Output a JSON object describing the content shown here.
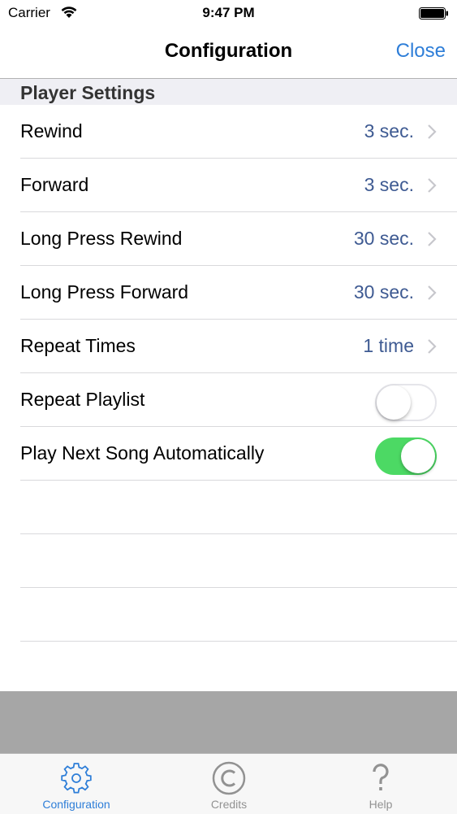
{
  "status_bar": {
    "carrier": "Carrier",
    "time": "9:47 PM"
  },
  "nav": {
    "title": "Configuration",
    "close_label": "Close"
  },
  "section": {
    "header": "Player Settings"
  },
  "settings": {
    "rewind": {
      "label": "Rewind",
      "value": "3 sec."
    },
    "forward": {
      "label": "Forward",
      "value": "3 sec."
    },
    "long_press_rewind": {
      "label": "Long Press Rewind",
      "value": "30 sec."
    },
    "long_press_forward": {
      "label": "Long Press Forward",
      "value": "30 sec."
    },
    "repeat_times": {
      "label": "Repeat Times",
      "value": "1 time"
    },
    "repeat_playlist": {
      "label": "Repeat Playlist",
      "on": false
    },
    "play_next": {
      "label": "Play Next Song Automatically",
      "on": true
    }
  },
  "tabs": [
    {
      "label": "Configuration",
      "icon": "gear-icon",
      "active": true
    },
    {
      "label": "Credits",
      "icon": "copyright-icon",
      "active": false
    },
    {
      "label": "Help",
      "icon": "question-icon",
      "active": false
    }
  ],
  "colors": {
    "accent": "#2e7ed8",
    "value_text": "#3e5a92",
    "toggle_on": "#4cd964",
    "section_bg": "#efeff4",
    "gray_area": "#a6a6a6"
  }
}
